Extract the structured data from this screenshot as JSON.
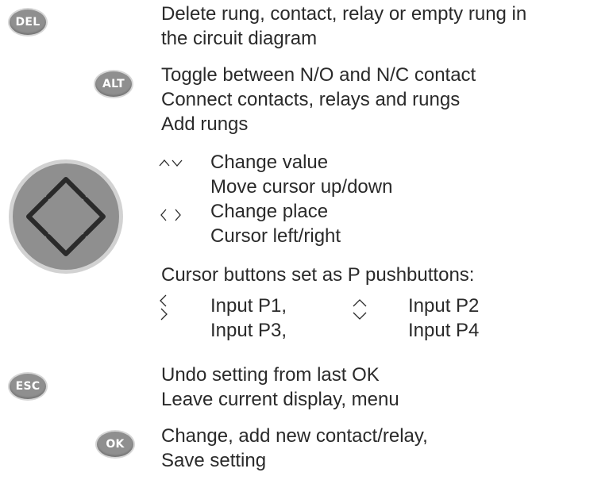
{
  "keys": {
    "del": "DEL",
    "alt": "ALT",
    "esc": "ESC",
    "ok": "OK"
  },
  "del_section": {
    "lines": [
      "Delete rung, contact, relay or empty rung in",
      "the circuit diagram"
    ]
  },
  "alt_section": {
    "lines": [
      "Toggle between N/O and N/C contact",
      "Connect contacts, relays and rungs",
      "Add rungs"
    ]
  },
  "cursor_section": {
    "updown_lines": [
      "Change value",
      "Move cursor up/down"
    ],
    "leftright_lines": [
      "Change place",
      "Cursor left/right"
    ],
    "pushbutton_heading": "Cursor buttons set as P pushbuttons:",
    "inputs": [
      "Input P1,",
      "Input P2",
      "Input P3,",
      "Input P4"
    ]
  },
  "esc_section": {
    "lines": [
      "Undo setting from last OK",
      "Leave current display, menu"
    ]
  },
  "ok_section": {
    "lines": [
      "Change, add new contact/relay,",
      "Save setting"
    ]
  },
  "colors": {
    "key_fill": "#8f8f8f",
    "key_rim": "#d6d6d6",
    "pad_fill": "#8f8f8f",
    "pad_rim": "#d2d2d2",
    "text": "#2a2a2a"
  },
  "icons": {
    "cursor_pad": "cursor-pad-icon",
    "up_down": "up-down-arrows-icon",
    "left_right": "left-right-arrows-icon",
    "left": "left-arrow-icon",
    "right": "right-arrow-icon",
    "up": "up-arrow-icon",
    "down": "down-arrow-icon"
  }
}
